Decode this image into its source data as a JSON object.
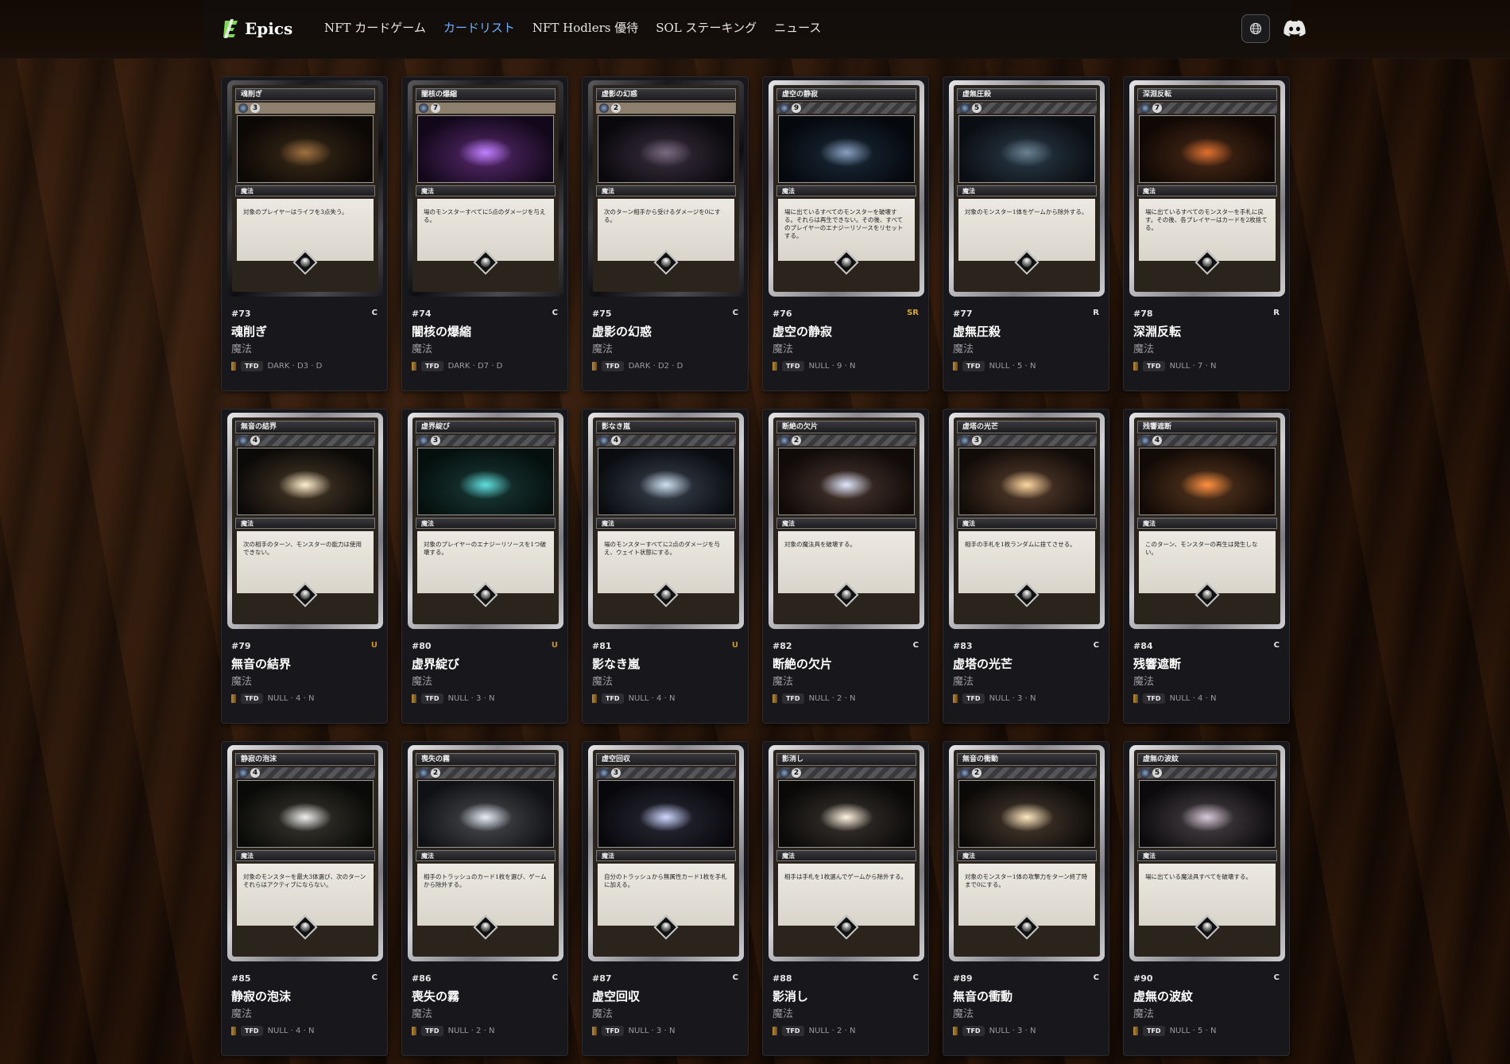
{
  "brand": {
    "name": "Epics"
  },
  "nav": [
    {
      "label": "NFT カードゲーム",
      "active": false
    },
    {
      "label": "カードリスト",
      "active": true
    },
    {
      "label": "NFT Hodlers 優待",
      "active": false
    },
    {
      "label": "SOL ステーキング",
      "active": false
    },
    {
      "label": "ニュース",
      "active": false
    }
  ],
  "icons": {
    "language": "globe-icon",
    "community": "discord-icon"
  },
  "colors": {
    "nav_active": "#6fb0ff",
    "rarity_sr": "#d9a441",
    "rarity_u": "#c9922a"
  },
  "cards": [
    {
      "num": "#73",
      "name": "魂削ぎ",
      "type": "魔法",
      "rarity": "C",
      "set": "TFD",
      "meta": "DARK · D3 · D",
      "cost": "3",
      "style": "dark",
      "text": "対象のプレイヤーはライフを3点失う。",
      "art": [
        "#3a2a18",
        "#0c0805",
        "#a07040"
      ]
    },
    {
      "num": "#74",
      "name": "闇核の爆縮",
      "type": "魔法",
      "rarity": "C",
      "set": "TFD",
      "meta": "DARK · D7 · D",
      "cost": "7",
      "style": "dark",
      "text": "場のモンスターすべてに5点のダメージを与える。",
      "art": [
        "#5a2a70",
        "#12081a",
        "#c080ff"
      ]
    },
    {
      "num": "#75",
      "name": "虚影の幻惑",
      "type": "魔法",
      "rarity": "C",
      "set": "TFD",
      "meta": "DARK · D2 · D",
      "cost": "2",
      "style": "dark",
      "text": "次のターン相手から受けるダメージを0にする。",
      "art": [
        "#3a3040",
        "#0a080c",
        "#7a6a80"
      ]
    },
    {
      "num": "#76",
      "name": "虚空の静寂",
      "type": "魔法",
      "rarity": "SR",
      "set": "TFD",
      "meta": "NULL · 9 · N",
      "cost": "9",
      "style": "silver",
      "text": "場に出ているすべてのモンスターを破壊する。それらは再生できない。その後、すべてのプレイヤーのエナジーリソースをリセットする。",
      "art": [
        "#1a2a3a",
        "#05080c",
        "#8aa0c0"
      ]
    },
    {
      "num": "#77",
      "name": "虚無圧殺",
      "type": "魔法",
      "rarity": "R",
      "set": "TFD",
      "meta": "NULL · 5 · N",
      "cost": "5",
      "style": "silver",
      "text": "対象のモンスター1体をゲームから除外する。",
      "art": [
        "#2a3a48",
        "#0a0e12",
        "#6a8090"
      ]
    },
    {
      "num": "#78",
      "name": "深淵反転",
      "type": "魔法",
      "rarity": "R",
      "set": "TFD",
      "meta": "NULL · 7 · N",
      "cost": "7",
      "style": "silver",
      "text": "場に出ているすべてのモンスターを手札に戻す。その後、各プレイヤーはカードを2枚捨てる。",
      "art": [
        "#4a2a18",
        "#100804",
        "#e07030"
      ]
    },
    {
      "num": "#79",
      "name": "無音の結界",
      "type": "魔法",
      "rarity": "U",
      "set": "TFD",
      "meta": "NULL · 4 · N",
      "cost": "4",
      "style": "silver",
      "text": "次の相手のターン、モンスターの能力は使用できない。",
      "art": [
        "#4a3a28",
        "#0c0a08",
        "#fff0d0"
      ]
    },
    {
      "num": "#80",
      "name": "虚界綻び",
      "type": "魔法",
      "rarity": "U",
      "set": "TFD",
      "meta": "NULL · 3 · N",
      "cost": "3",
      "style": "silver",
      "text": "対象のプレイヤーのエナジーリソースを1つ破壊する。",
      "art": [
        "#1a3a38",
        "#05100e",
        "#60e0e0"
      ]
    },
    {
      "num": "#81",
      "name": "影なき嵐",
      "type": "魔法",
      "rarity": "U",
      "set": "TFD",
      "meta": "NULL · 4 · N",
      "cost": "4",
      "style": "silver",
      "text": "場のモンスターすべてに2点のダメージを与え、ウェイト状態にする。",
      "art": [
        "#3a4450",
        "#0a0c10",
        "#d0e0f0"
      ]
    },
    {
      "num": "#82",
      "name": "断絶の欠片",
      "type": "魔法",
      "rarity": "C",
      "set": "TFD",
      "meta": "NULL · 2 · N",
      "cost": "2",
      "style": "silver",
      "text": "対象の魔法具を破壊する。",
      "art": [
        "#4a3830",
        "#100a08",
        "#e0e8ff"
      ]
    },
    {
      "num": "#83",
      "name": "虚塔の光芒",
      "type": "魔法",
      "rarity": "C",
      "set": "TFD",
      "meta": "NULL · 3 · N",
      "cost": "3",
      "style": "silver",
      "text": "相手の手札を1枚ランダムに捨てさせる。",
      "art": [
        "#5a4030",
        "#120c08",
        "#ffd8a0"
      ]
    },
    {
      "num": "#84",
      "name": "残響遮断",
      "type": "魔法",
      "rarity": "C",
      "set": "TFD",
      "meta": "NULL · 4 · N",
      "cost": "4",
      "style": "silver",
      "text": "このターン、モンスターの再生は発生しない。",
      "art": [
        "#5a3820",
        "#120a06",
        "#ff9040"
      ]
    },
    {
      "num": "#85",
      "name": "静寂の泡沫",
      "type": "魔法",
      "rarity": "C",
      "set": "TFD",
      "meta": "NULL · 4 · N",
      "cost": "4",
      "style": "silver",
      "text": "対象のモンスターを最大3体選び、次のターンそれらはアクティブにならない。",
      "art": [
        "#3a3830",
        "#0a0a08",
        "#f0f0f0"
      ]
    },
    {
      "num": "#86",
      "name": "喪失の霧",
      "type": "魔法",
      "rarity": "C",
      "set": "TFD",
      "meta": "NULL · 2 · N",
      "cost": "2",
      "style": "silver",
      "text": "相手のトラッシュのカード1枚を選び、ゲームから除外する。",
      "art": [
        "#4a4c50",
        "#101114",
        "#e8eef8"
      ]
    },
    {
      "num": "#87",
      "name": "虚空回収",
      "type": "魔法",
      "rarity": "C",
      "set": "TFD",
      "meta": "NULL · 3 · N",
      "cost": "3",
      "style": "silver",
      "text": "自分のトラッシュから無属性カード1枚を手札に加える。",
      "art": [
        "#2a2a38",
        "#08080c",
        "#d0d8ff"
      ]
    },
    {
      "num": "#88",
      "name": "影消し",
      "type": "魔法",
      "rarity": "C",
      "set": "TFD",
      "meta": "NULL · 2 · N",
      "cost": "2",
      "style": "silver",
      "text": "相手は手札を1枚選んでゲームから除外する。",
      "art": [
        "#3a3430",
        "#0a0908",
        "#fff4e0"
      ]
    },
    {
      "num": "#89",
      "name": "無音の衝動",
      "type": "魔法",
      "rarity": "C",
      "set": "TFD",
      "meta": "NULL · 3 · N",
      "cost": "2",
      "style": "silver",
      "text": "対象のモンスター1体の攻撃力をターン終了時まで0にする。",
      "art": [
        "#4a3c30",
        "#0c0a08",
        "#ffe8c0"
      ]
    },
    {
      "num": "#90",
      "name": "虚無の波紋",
      "type": "魔法",
      "rarity": "C",
      "set": "TFD",
      "meta": "NULL · 5 · N",
      "cost": "5",
      "style": "silver",
      "text": "場に出ている魔法具すべてを破壊する。",
      "art": [
        "#4a4448",
        "#0c0a0c",
        "#d8c8d8"
      ]
    }
  ]
}
